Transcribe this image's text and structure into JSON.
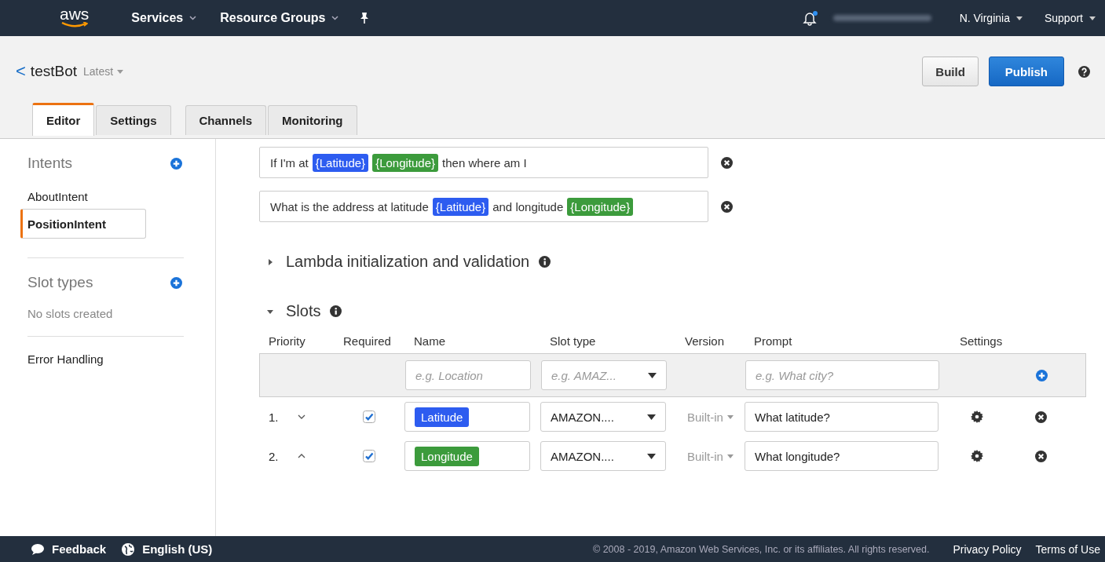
{
  "nav": {
    "logo": "aws",
    "menus": [
      {
        "label": "Services"
      },
      {
        "label": "Resource Groups"
      }
    ],
    "notification_dot": true,
    "right_menus": [
      {
        "label": "N. Virginia"
      },
      {
        "label": "Support"
      }
    ]
  },
  "header": {
    "back": "<",
    "bot_name": "testBot",
    "version": "Latest",
    "buttons": [
      {
        "label": "Build",
        "primary": false
      },
      {
        "label": "Publish",
        "primary": true
      }
    ]
  },
  "tabs": [
    {
      "label": "Editor",
      "selected": true
    },
    {
      "label": "Settings",
      "selected": false
    },
    {
      "label": "Channels",
      "selected": false
    },
    {
      "label": "Monitoring",
      "selected": false
    }
  ],
  "sidebar": {
    "sections": [
      {
        "title": "Intents",
        "addable": true,
        "items": [
          {
            "label": "AboutIntent",
            "selected": false
          },
          {
            "label": "PositionIntent",
            "selected": true
          }
        ]
      },
      {
        "title": "Slot types",
        "addable": true,
        "empty_text": "No slots created"
      },
      {
        "title": "Error Handling",
        "addable": false
      }
    ]
  },
  "utterances": [
    {
      "segments": [
        {
          "kind": "text",
          "text": "If I'm at"
        },
        {
          "kind": "slot",
          "text": "{Latitude}",
          "color": "#2d5cf0"
        },
        {
          "kind": "slot",
          "text": "{Longitude}",
          "color": "#3c9b3c"
        },
        {
          "kind": "text",
          "text": "then where am I"
        }
      ]
    },
    {
      "segments": [
        {
          "kind": "text",
          "text": "What is the address at latitude"
        },
        {
          "kind": "slot",
          "text": "{Latitude}",
          "color": "#2d5cf0"
        },
        {
          "kind": "text",
          "text": "and longitude"
        },
        {
          "kind": "slot",
          "text": "{Longitude}",
          "color": "#3c9b3c"
        }
      ]
    }
  ],
  "lambda_section": {
    "title": "Lambda initialization and validation",
    "expanded": false
  },
  "slots_section": {
    "title": "Slots",
    "expanded": true,
    "columns": [
      "Priority",
      "Required",
      "Name",
      "Slot type",
      "Version",
      "Prompt",
      "Settings"
    ],
    "new_row": {
      "name_placeholder": "e.g. Location",
      "type_placeholder": "e.g. AMAZ...",
      "prompt_placeholder": "e.g. What city?"
    },
    "rows": [
      {
        "priority": "1.",
        "move_up": false,
        "required": true,
        "name": "Latitude",
        "color": "#2d5cf0",
        "slot_type": "AMAZON....",
        "version": "Built-in",
        "prompt": "What latitude?"
      },
      {
        "priority": "2.",
        "move_up": true,
        "required": true,
        "name": "Longitude",
        "color": "#3c9b3c",
        "slot_type": "AMAZON....",
        "version": "Built-in",
        "prompt": "What longitude?"
      }
    ]
  },
  "footer": {
    "feedback": "Feedback",
    "language": "English (US)",
    "copyright": "© 2008 - 2019, Amazon Web Services, Inc. or its affiliates. All rights reserved.",
    "links": [
      "Privacy Policy",
      "Terms of Use"
    ]
  }
}
